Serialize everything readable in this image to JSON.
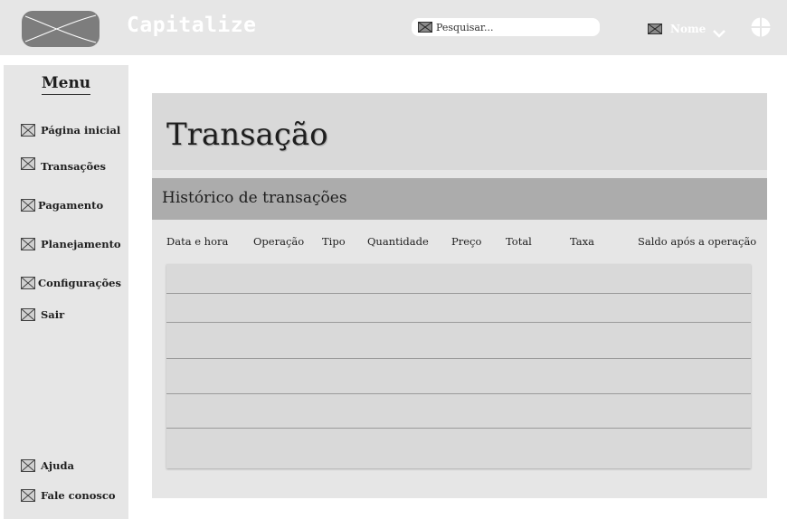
{
  "header": {
    "brand": "Capitalize",
    "search": {
      "placeholder": "Pesquisar..."
    },
    "user": {
      "name": "Nome"
    }
  },
  "sidebar": {
    "title": "Menu",
    "items": [
      {
        "label": "Página inicial",
        "icon": "placeholder-image-icon"
      },
      {
        "label": "Transações",
        "icon": "placeholder-image-icon"
      },
      {
        "label": "Pagamento",
        "icon": "placeholder-image-icon"
      },
      {
        "label": "Planejamento",
        "icon": "placeholder-image-icon"
      },
      {
        "label": "Configurações",
        "icon": "placeholder-image-icon"
      },
      {
        "label": "Sair",
        "icon": "placeholder-image-icon"
      }
    ],
    "bottom_items": [
      {
        "label": "Ajuda",
        "icon": "placeholder-image-icon"
      },
      {
        "label": "Fale conosco",
        "icon": "placeholder-image-icon"
      }
    ]
  },
  "main": {
    "title": "Transação",
    "section_title": "Histórico de transações",
    "table": {
      "columns": [
        "Data e hora",
        "Operação",
        "Tipo",
        "Quantidade",
        "Preço",
        "Total",
        "Taxa",
        "Saldo após a operação"
      ],
      "rows": [
        [
          "",
          "",
          "",
          "",
          "",
          "",
          "",
          ""
        ],
        [
          "",
          "",
          "",
          "",
          "",
          "",
          "",
          ""
        ],
        [
          "",
          "",
          "",
          "",
          "",
          "",
          "",
          ""
        ],
        [
          "",
          "",
          "",
          "",
          "",
          "",
          "",
          ""
        ],
        [
          "",
          "",
          "",
          "",
          "",
          "",
          "",
          ""
        ],
        [
          "",
          "",
          "",
          "",
          "",
          "",
          "",
          ""
        ]
      ]
    }
  },
  "colors": {
    "topbar": "#e6e6e6",
    "sidebar": "#e6e6e6",
    "card": "#e6e6e6",
    "card_header": "#d9d9d9",
    "section_bar": "#acacac",
    "table_body": "#d9d9d9",
    "logo_placeholder": "#7d7d7d",
    "text": "#1e1e1e"
  }
}
